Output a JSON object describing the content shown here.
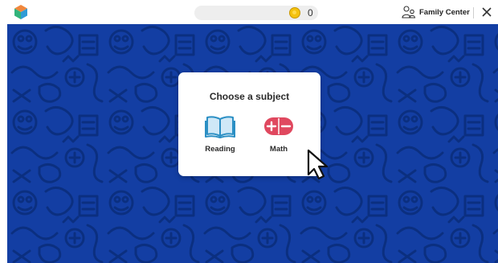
{
  "header": {
    "coins": "0",
    "family_center_label": "Family Center"
  },
  "dialog": {
    "title": "Choose a subject",
    "subjects": [
      {
        "label": "Reading",
        "icon": "book-icon"
      },
      {
        "label": "Math",
        "icon": "plus-minus-icon"
      }
    ]
  },
  "colors": {
    "stage_background": "#133ea3",
    "reading_icon": "#2b8fc4",
    "math_icon": "#e0485f"
  }
}
